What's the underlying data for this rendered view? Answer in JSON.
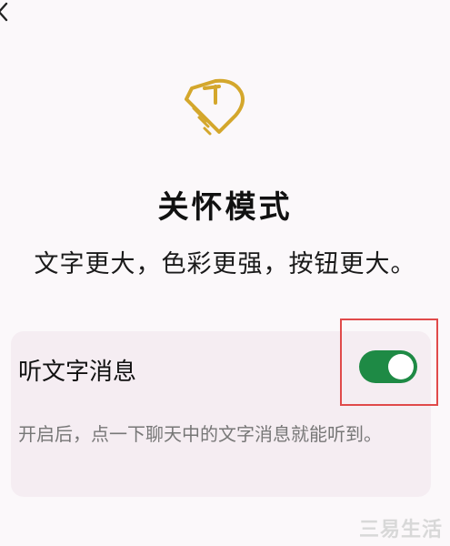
{
  "header": {
    "back_icon": "chevron-left-icon"
  },
  "hero": {
    "icon": "care-mode-icon",
    "icon_color": "#d4a72c"
  },
  "title": "关怀模式",
  "subtitle": "文字更大，色彩更强，按钮更大。",
  "setting": {
    "label": "听文字消息",
    "toggle_on": true,
    "toggle_color": "#1e8a45",
    "description": "开启后，点一下聊天中的文字消息就能听到。"
  },
  "watermark": "三易生活"
}
